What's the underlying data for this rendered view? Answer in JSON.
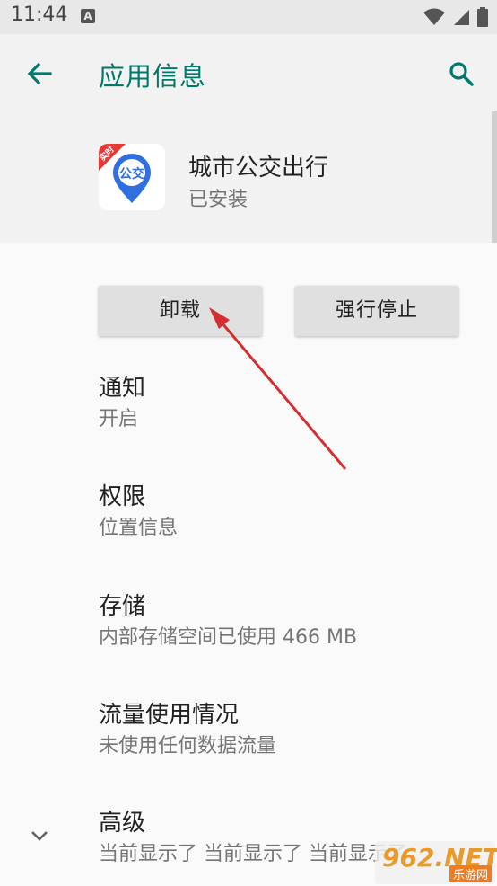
{
  "status_bar": {
    "time": "11:44",
    "a_badge": "A"
  },
  "toolbar": {
    "title": "应用信息",
    "back_icon": "arrow-back-icon",
    "search_icon": "search-icon"
  },
  "app": {
    "name": "城市公交出行",
    "status": "已安装",
    "icon_badge": "实时",
    "icon_text": "公交",
    "icon_color": "#2f6fe0",
    "icon_badge_color": "#e53935"
  },
  "buttons": {
    "uninstall": "卸载",
    "force_stop": "强行停止"
  },
  "prefs": [
    {
      "title": "通知",
      "summary": "开启"
    },
    {
      "title": "权限",
      "summary": "位置信息"
    },
    {
      "title": "存储",
      "summary": "内部存储空间已使用 466 MB"
    },
    {
      "title": "流量使用情况",
      "summary": "未使用任何数据流量"
    },
    {
      "title": "高级",
      "summary": "当前显示了 当前显示了 当前显示了"
    }
  ],
  "watermark": {
    "logo": "962.NET",
    "sub": "乐游网"
  },
  "colors": {
    "accent": "#00796b",
    "annotation_arrow": "#d32f2f"
  }
}
